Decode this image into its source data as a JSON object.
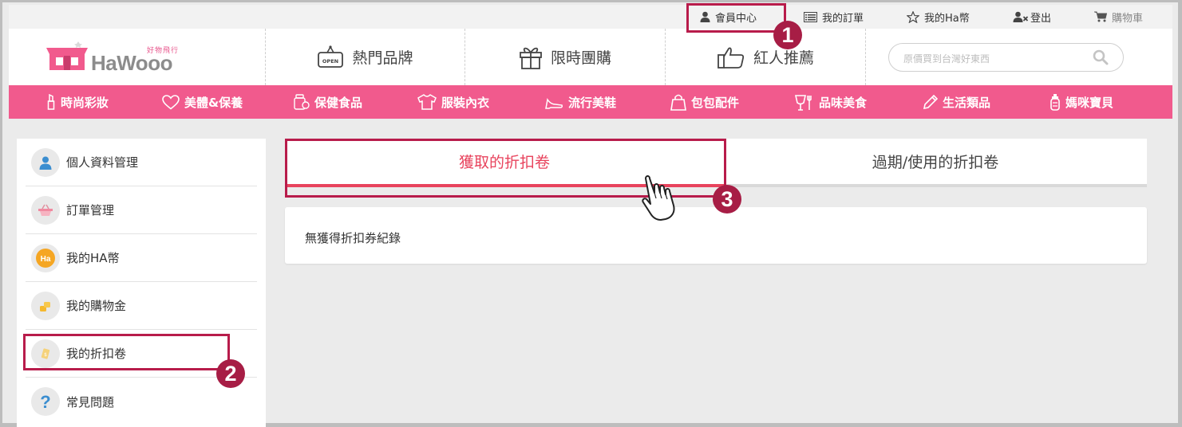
{
  "topbar": {
    "items": [
      {
        "label": "會員中心",
        "icon": "user-icon"
      },
      {
        "label": "我的訂單",
        "icon": "order-list-icon"
      },
      {
        "label": "我的Ha幣",
        "icon": "star-icon"
      },
      {
        "label": "登出",
        "icon": "logout-user-icon"
      },
      {
        "label": "購物車",
        "icon": "cart-icon"
      }
    ]
  },
  "header": {
    "logo_text": "HaWooo",
    "logo_subtitle": "好物飛行",
    "nav": [
      {
        "label": "熱門品牌",
        "icon": "open-sign-icon"
      },
      {
        "label": "限時團購",
        "icon": "gift-icon"
      },
      {
        "label": "紅人推薦",
        "icon": "thumbs-up-icon"
      }
    ],
    "search_placeholder": "原價買到台灣好東西"
  },
  "categories": [
    {
      "label": "時尚彩妝",
      "icon": "lipstick-icon"
    },
    {
      "label": "美體&保養",
      "icon": "heart-icon"
    },
    {
      "label": "保健食品",
      "icon": "supplement-icon"
    },
    {
      "label": "服裝內衣",
      "icon": "shirt-icon"
    },
    {
      "label": "流行美鞋",
      "icon": "heel-icon"
    },
    {
      "label": "包包配件",
      "icon": "bag-icon"
    },
    {
      "label": "品味美食",
      "icon": "cup-fork-icon"
    },
    {
      "label": "生活類品",
      "icon": "pencil-icon"
    },
    {
      "label": "媽咪寶貝",
      "icon": "baby-bottle-icon"
    }
  ],
  "sidebar": {
    "items": [
      {
        "label": "個人資料管理",
        "icon": "profile-icon"
      },
      {
        "label": "訂單管理",
        "icon": "basket-icon"
      },
      {
        "label": "我的HA幣",
        "icon": "ha-coin-icon",
        "badge": "Ha"
      },
      {
        "label": "我的購物金",
        "icon": "coins-icon"
      },
      {
        "label": "我的折扣卷",
        "icon": "coupon-icon"
      },
      {
        "label": "常見問題",
        "icon": "question-icon",
        "badge": "?"
      }
    ]
  },
  "tabs": {
    "active": "獲取的折扣卷",
    "inactive": "過期/使用的折扣卷"
  },
  "panel": {
    "message": "無獲得折扣券紀錄"
  },
  "annotations": {
    "step1": "1",
    "step2": "2",
    "step3": "3"
  },
  "colors": {
    "brand_pink": "#f15a8d",
    "active_red": "#e8435d",
    "highlight": "#b81c4b"
  }
}
